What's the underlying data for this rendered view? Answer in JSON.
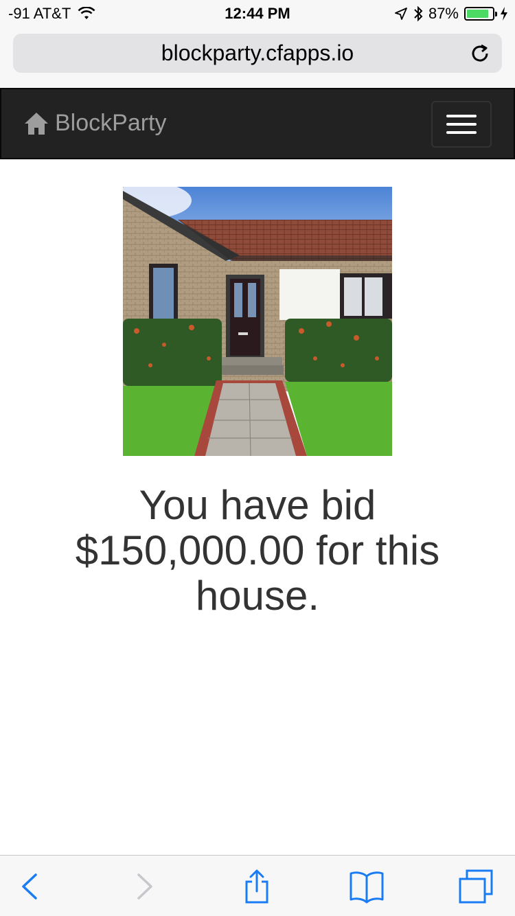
{
  "status_bar": {
    "carrier": "-91 AT&T",
    "time": "12:44 PM",
    "battery_percent": "87%",
    "battery_level": 0.87,
    "icons": [
      "wifi-icon",
      "location-icon",
      "bluetooth-icon",
      "battery-icon",
      "charging-icon"
    ]
  },
  "browser": {
    "url": "blockparty.cfapps.io",
    "toolbar": [
      "back-icon",
      "forward-icon",
      "share-icon",
      "bookmarks-icon",
      "tabs-icon"
    ]
  },
  "navbar": {
    "brand": "BlockParty",
    "brand_icon": "home-icon",
    "menu_icon": "hamburger-icon"
  },
  "content": {
    "image_subject": "house-photo",
    "message": "You have bid $150,000.00 for this house."
  },
  "colors": {
    "navbar_bg": "#222222",
    "brand_text": "#9d9d9d",
    "ios_blue": "#1a7cf5",
    "battery_green": "#4cd964"
  }
}
